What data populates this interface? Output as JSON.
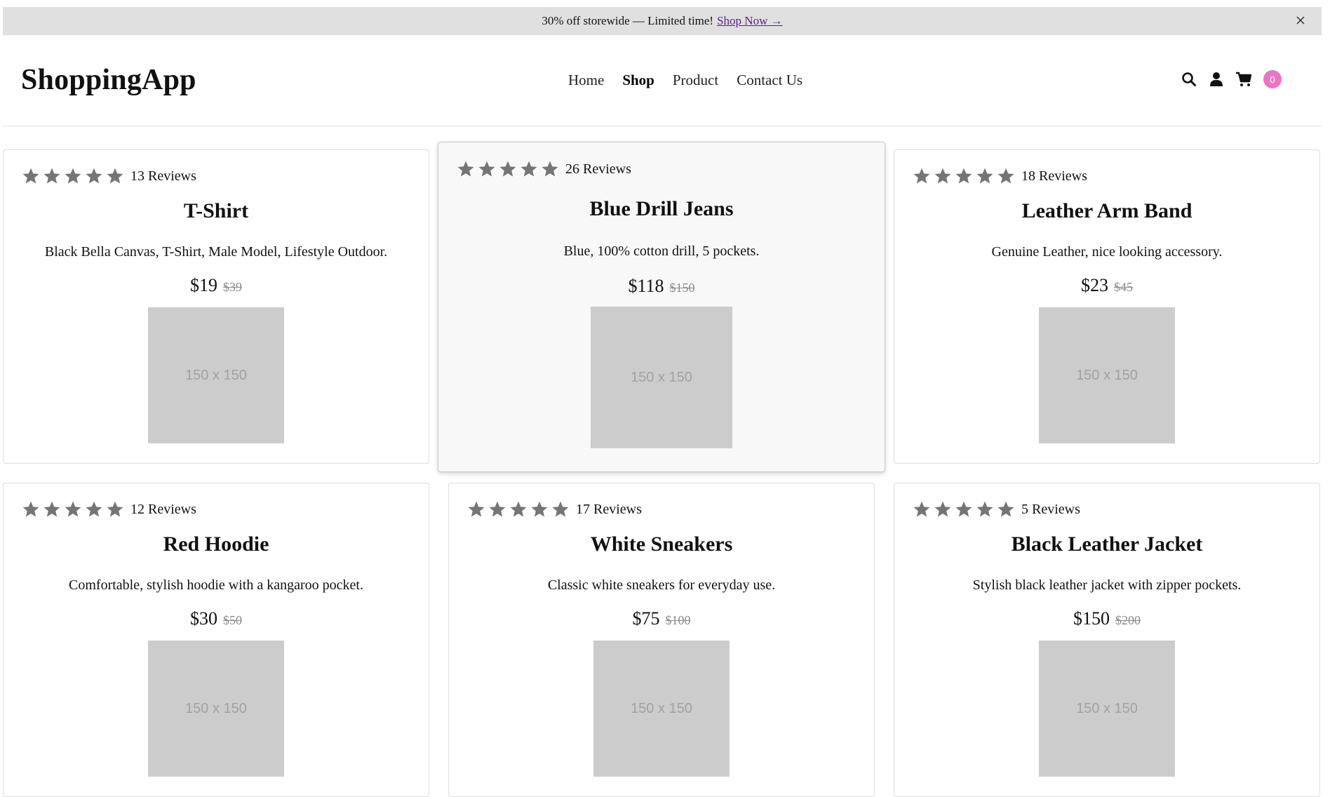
{
  "promo": {
    "text": "30% off storewide — Limited time!",
    "link": "Shop Now →"
  },
  "header": {
    "logo": "ShoppingApp",
    "nav": [
      "Home",
      "Shop",
      "Product",
      "Contact Us"
    ],
    "active_nav": "Shop",
    "icons": [
      "search-icon",
      "user-icon",
      "cart-icon"
    ],
    "cart_count": "0",
    "badge_color": "#ea76c2"
  },
  "products": [
    {
      "reviews": "13 Reviews",
      "title": "T-Shirt",
      "description": "Black Bella Canvas, T-Shirt, Male Model, Lifestyle Outdoor.",
      "price": "$19",
      "old_price": "$39",
      "image_label": "150 x 150"
    },
    {
      "reviews": "26 Reviews",
      "title": "Blue Drill Jeans",
      "description": "Blue, 100% cotton drill, 5 pockets.",
      "price": "$118",
      "old_price": "$150",
      "image_label": "150 x 150"
    },
    {
      "reviews": "18 Reviews",
      "title": "Leather Arm Band",
      "description": "Genuine Leather, nice looking accessory.",
      "price": "$23",
      "old_price": "$45",
      "image_label": "150 x 150"
    },
    {
      "reviews": "12 Reviews",
      "title": "Red Hoodie",
      "description": "Comfortable, stylish hoodie with a kangaroo pocket.",
      "price": "$30",
      "old_price": "$50",
      "image_label": "150 x 150"
    },
    {
      "reviews": "17 Reviews",
      "title": "White Sneakers",
      "description": "Classic white sneakers for everyday use.",
      "price": "$75",
      "old_price": "$100",
      "image_label": "150 x 150"
    },
    {
      "reviews": "5 Reviews",
      "title": "Black Leather Jacket",
      "description": "Stylish black leather jacket with zipper pockets.",
      "price": "$150",
      "old_price": "$200",
      "image_label": "150 x 150"
    }
  ]
}
